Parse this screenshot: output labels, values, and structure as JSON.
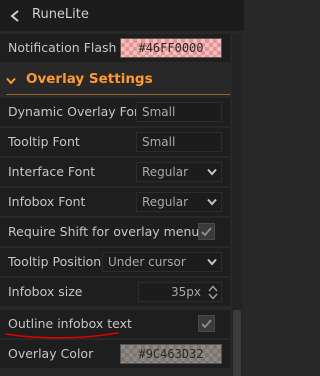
{
  "app": {
    "title": "RuneLite"
  },
  "rows": {
    "notification_flash": {
      "label": "Notification Flash",
      "hex": "#46FF0000",
      "color": "#ff0000",
      "alpha": 0.27
    },
    "section": {
      "label": "Overlay Settings",
      "accent": "#ff9933"
    },
    "dynamic_overlay_font": {
      "label": "Dynamic Overlay Font",
      "value": "Small"
    },
    "tooltip_font": {
      "label": "Tooltip Font",
      "value": "Small"
    },
    "interface_font": {
      "label": "Interface Font",
      "value": "Regular"
    },
    "infobox_font": {
      "label": "Infobox Font",
      "value": "Regular"
    },
    "require_shift": {
      "label": "Require Shift for overlay menu",
      "checked": true
    },
    "tooltip_position": {
      "label": "Tooltip Position",
      "value": "Under cursor"
    },
    "infobox_size": {
      "label": "Infobox size",
      "value": "35px"
    },
    "outline_infobox_text": {
      "label": "Outline infobox text",
      "checked": true
    },
    "overlay_color": {
      "label": "Overlay Color",
      "hex": "#9C463D32",
      "color": "#463d32",
      "alpha": 0.61
    }
  },
  "icons": {
    "back": "chevron-left-icon",
    "collapse": "chevron-down-icon",
    "dropdown": "chevron-down-icon",
    "check": "check-icon",
    "spin_up": "chevron-up-icon",
    "spin_down": "chevron-down-icon"
  },
  "colors": {
    "background": "#282828",
    "row": "#1e1e1e",
    "accent": "#ff9933",
    "annotation": "#e00000"
  }
}
